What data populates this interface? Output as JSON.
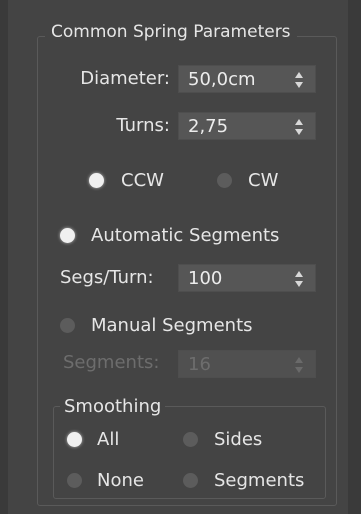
{
  "panel": {
    "title": "Common Spring Parameters",
    "diameter": {
      "label": "Diameter:",
      "value": "50,0cm"
    },
    "turns": {
      "label": "Turns:",
      "value": "2,75"
    },
    "direction": {
      "ccw_label": "CCW",
      "cw_label": "CW",
      "selected": "CCW"
    },
    "automatic_segments": {
      "label": "Automatic Segments",
      "selected": true
    },
    "segs_per_turn": {
      "label": "Segs/Turn:",
      "value": "100"
    },
    "manual_segments": {
      "label": "Manual Segments",
      "selected": false
    },
    "segments": {
      "label": "Segments:",
      "value": "16",
      "disabled": true
    },
    "smoothing": {
      "title": "Smoothing",
      "options": [
        "All",
        "Sides",
        "None",
        "Segments"
      ],
      "selected": "All"
    }
  },
  "colors": {
    "background": "#444444",
    "field": "#565656",
    "text": "#e6e6e6",
    "disabled_text": "#6d6d6d"
  },
  "icons": [
    "spinner-arrows-icon",
    "radio-button"
  ]
}
